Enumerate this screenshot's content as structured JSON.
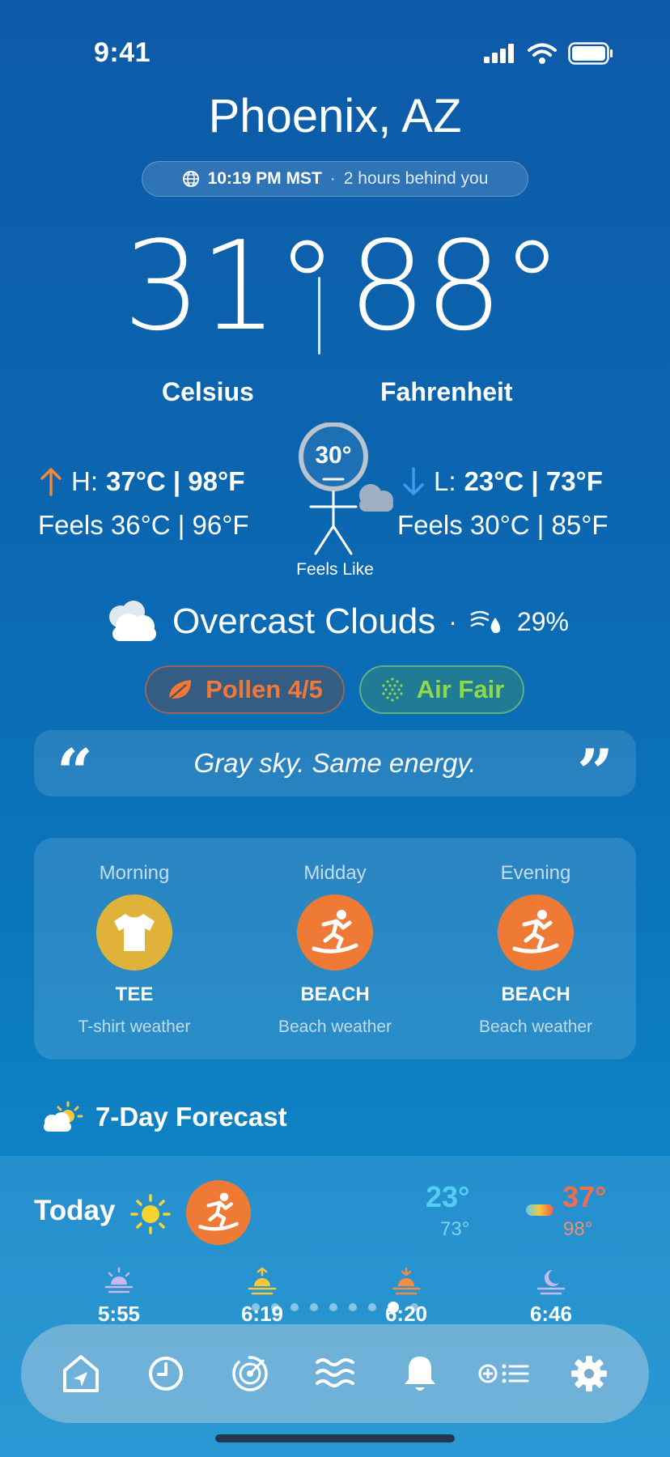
{
  "status_bar": {
    "time": "9:41"
  },
  "location": {
    "city": "Phoenix, AZ",
    "local_time": "10:19 PM MST",
    "separator": "·",
    "offset": "2 hours behind you"
  },
  "current": {
    "temp_c": "31°",
    "temp_f": "88°",
    "label_c": "Celsius",
    "label_f": "Fahrenheit",
    "high_label": "H:",
    "high_value": "37°C | 98°F",
    "high_feels": "Feels 36°C | 96°F",
    "low_label": "L:",
    "low_value": "23°C | 73°F",
    "low_feels": "Feels 30°C | 85°F",
    "feels_like_temp": "30°",
    "feels_like_label": "Feels Like",
    "condition": "Overcast Clouds",
    "condition_separator": "·",
    "humidity": "29%"
  },
  "badges": {
    "pollen": "Pollen 4/5",
    "air": "Air Fair"
  },
  "quote": {
    "open_mark": "“",
    "text": "Gray sky. Same energy.",
    "close_mark": "”"
  },
  "outfits": [
    {
      "period": "Morning",
      "name": "TEE",
      "desc": "T-shirt weather",
      "icon": "tshirt-icon",
      "color": "#e0b23a"
    },
    {
      "period": "Midday",
      "name": "BEACH",
      "desc": "Beach weather",
      "icon": "surfer-icon",
      "color": "#ef7a35"
    },
    {
      "period": "Evening",
      "name": "BEACH",
      "desc": "Beach weather",
      "icon": "surfer-icon",
      "color": "#ef7a35"
    }
  ],
  "forecast": {
    "title": "7-Day Forecast",
    "today": {
      "label": "Today",
      "low_c": "23°",
      "low_f": "73°",
      "high_c": "37°",
      "high_f": "98°"
    },
    "sun_times": [
      {
        "time": "5:55",
        "icon": "dawn-icon"
      },
      {
        "time": "6:19",
        "icon": "sunrise-icon"
      },
      {
        "time": "6:20",
        "icon": "sunset-icon"
      },
      {
        "time": "6:46",
        "icon": "dusk-moon-icon"
      }
    ],
    "page_count": 9,
    "active_page": 8
  },
  "tabbar": [
    {
      "name": "home-tab",
      "icon": "home-location-icon"
    },
    {
      "name": "history-tab",
      "icon": "clock-icon"
    },
    {
      "name": "radar-tab",
      "icon": "radar-icon"
    },
    {
      "name": "waves-tab",
      "icon": "waves-icon"
    },
    {
      "name": "alerts-tab",
      "icon": "bell-icon"
    },
    {
      "name": "locations-tab",
      "icon": "add-list-icon"
    },
    {
      "name": "settings-tab",
      "icon": "gear-icon"
    }
  ],
  "colors": {
    "accent_high": "#f08a3a",
    "accent_low": "#3b9cf0",
    "pollen": "#f07838",
    "air": "#8fd84a"
  }
}
